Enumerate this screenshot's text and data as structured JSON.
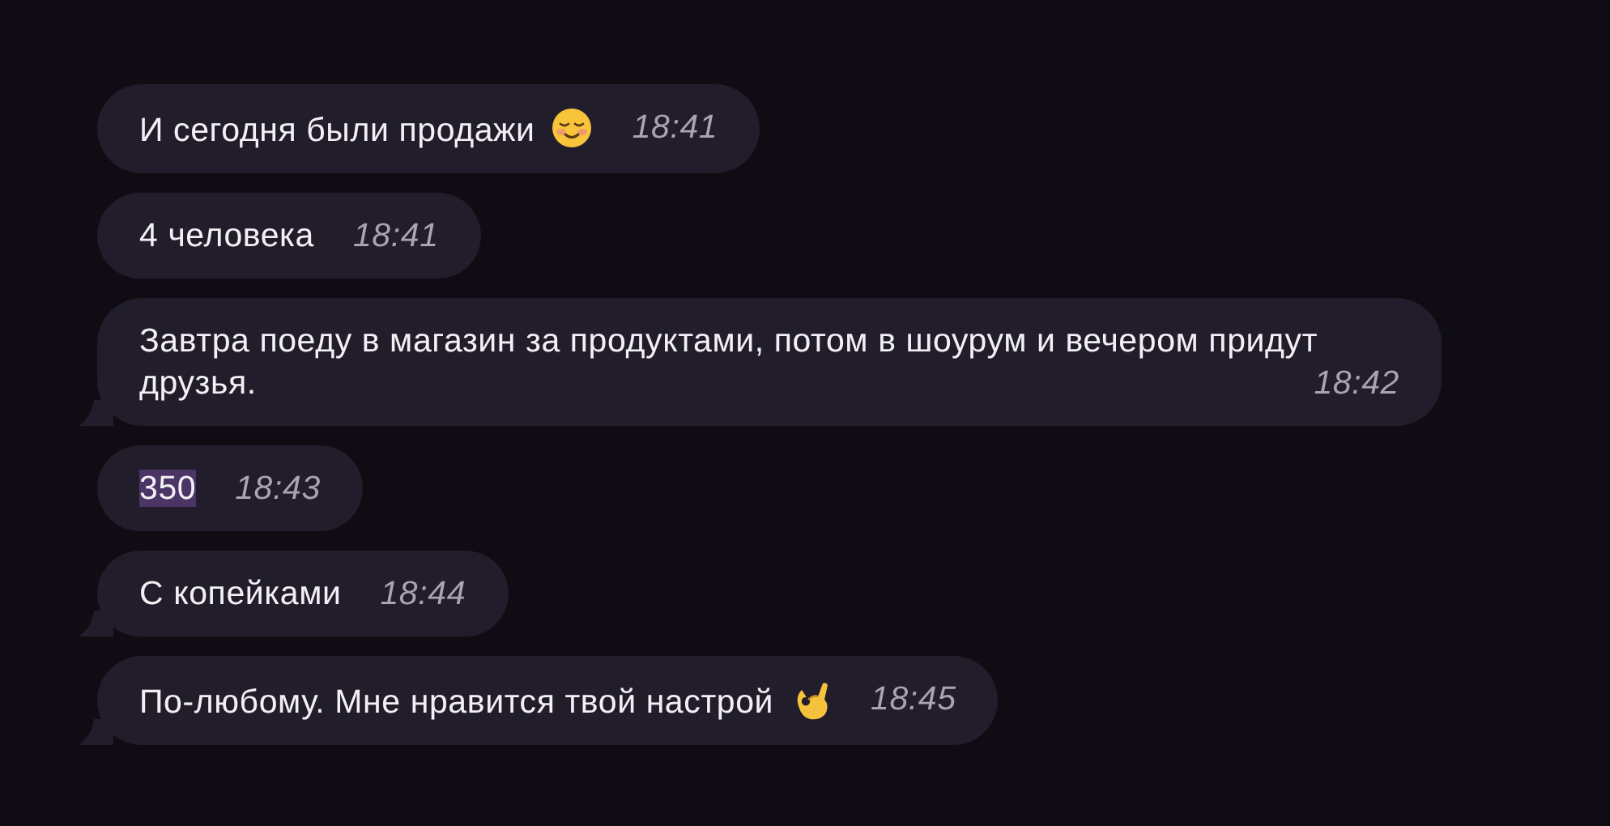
{
  "messages": [
    {
      "kind": "smile",
      "text": "И сегодня были продажи",
      "time": "18:41",
      "tail": false,
      "text_selected": false
    },
    {
      "kind": "plain",
      "text": "4 человека",
      "time": "18:41",
      "tail": false,
      "text_selected": false
    },
    {
      "kind": "plain",
      "text": "Завтра поеду в магазин за продуктами, потом в шоурум и вечером придут друзья.",
      "time": "18:42",
      "tail": true,
      "text_selected": false
    },
    {
      "kind": "plain",
      "text": "350",
      "time": "18:43",
      "tail": false,
      "text_selected": true
    },
    {
      "kind": "plain",
      "text": "С копейками",
      "time": "18:44",
      "tail": true,
      "text_selected": false
    },
    {
      "kind": "okhand",
      "text": "По-любому. Мне нравится твой настрой",
      "time": "18:45",
      "tail": true,
      "text_selected": false
    }
  ]
}
